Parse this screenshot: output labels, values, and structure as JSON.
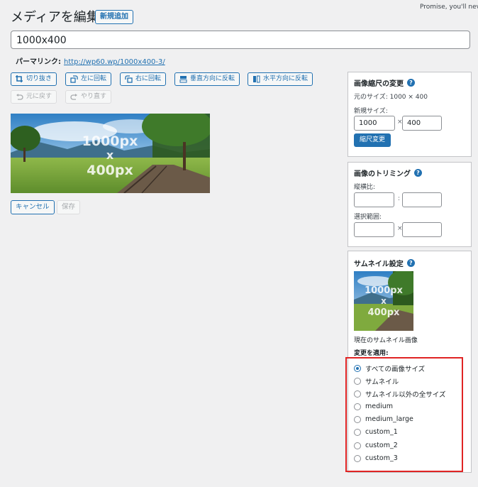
{
  "header": {
    "title": "メディアを編集",
    "add_new": "新規追加",
    "notice": "Promise, you'll never g"
  },
  "title_field": {
    "value": "1000x400"
  },
  "permalink": {
    "label": "パーマリンク:",
    "url": "http://wp60.wp/1000x400-3/"
  },
  "toolbar": {
    "crop": "切り抜き",
    "rotate_left": "左に回転",
    "rotate_right": "右に回転",
    "flip_vertical": "垂直方向に反転",
    "flip_horizontal": "水平方向に反転",
    "undo": "元に戻す",
    "redo": "やり直す"
  },
  "image": {
    "overlay_line1": "1000px",
    "overlay_line2": "x",
    "overlay_line3": "400px"
  },
  "actions": {
    "cancel": "キャンセル",
    "save": "保存"
  },
  "scale_panel": {
    "title": "画像縮尺の変更",
    "original_size": "元のサイズ: 1000 × 400",
    "new_size_label": "新規サイズ:",
    "width": "1000",
    "height": "400",
    "times": "×",
    "button": "縮尺変更"
  },
  "crop_panel": {
    "title": "画像のトリミング",
    "aspect_label": "縦横比:",
    "aspect_sep": ":",
    "selection_label": "選択範囲:",
    "selection_sep": "×"
  },
  "thumb_panel": {
    "title": "サムネイル設定",
    "current_caption": "現在のサムネイル画像",
    "apply_label": "変更を適用:",
    "options": [
      {
        "label": "すべての画像サイズ",
        "checked": true
      },
      {
        "label": "サムネイル",
        "checked": false
      },
      {
        "label": "サムネイル以外の全サイズ",
        "checked": false
      },
      {
        "label": "medium",
        "checked": false
      },
      {
        "label": "medium_large",
        "checked": false
      },
      {
        "label": "custom_1",
        "checked": false
      },
      {
        "label": "custom_2",
        "checked": false
      },
      {
        "label": "custom_3",
        "checked": false
      }
    ]
  },
  "colors": {
    "accent": "#2271b1",
    "highlight": "#e02424"
  }
}
